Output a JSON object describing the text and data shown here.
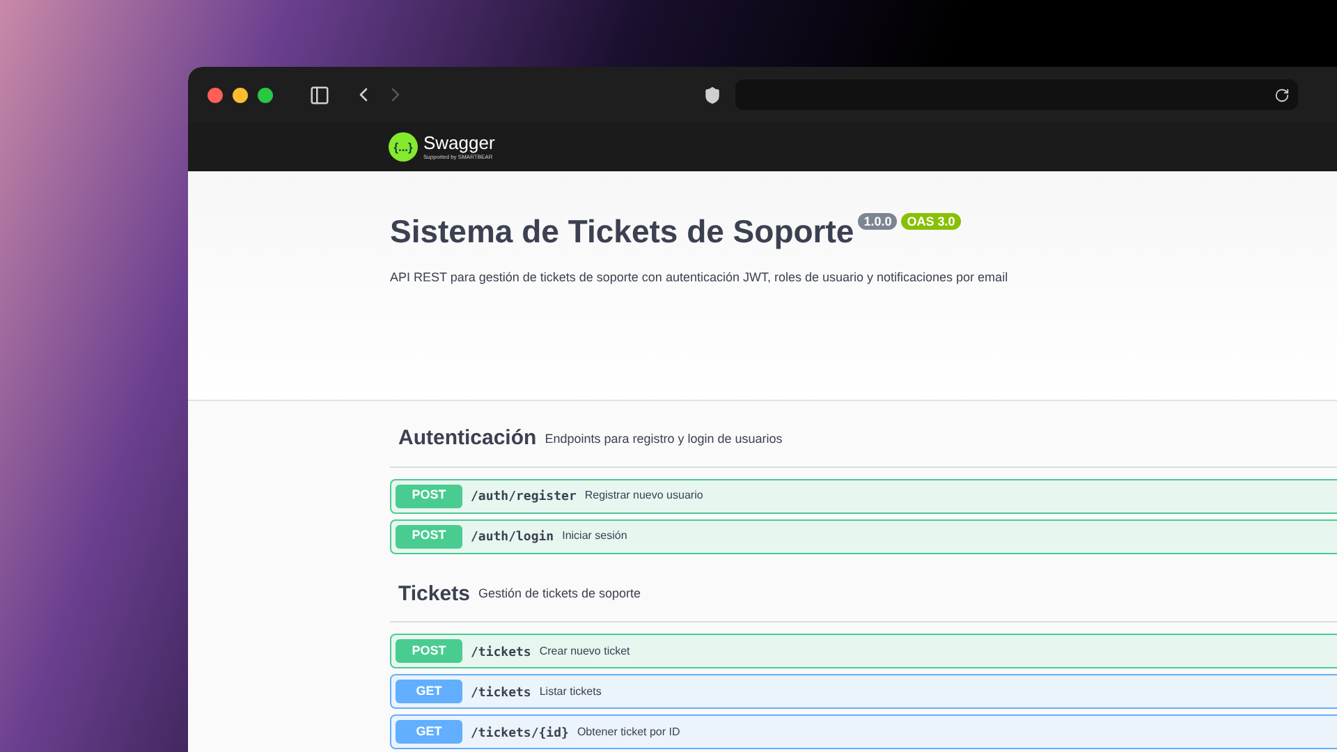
{
  "browser": {
    "back_enabled": true,
    "forward_enabled": false
  },
  "header": {
    "logo_mark": "{...}",
    "logo": "Swagger",
    "tagline": "Supported by SMARTBEAR"
  },
  "info": {
    "title": "Sistema de Tickets de Soporte",
    "version": "1.0.0",
    "oas": "OAS 3.0",
    "description": "API REST para gestión de tickets de soporte con autenticación JWT, roles de usuario y notificaciones por email"
  },
  "sections": [
    {
      "name": "Autenticación",
      "description": "Endpoints para registro y login de usuarios",
      "operations": [
        {
          "method": "POST",
          "path": "/auth/register",
          "summary": "Registrar nuevo usuario"
        },
        {
          "method": "POST",
          "path": "/auth/login",
          "summary": "Iniciar sesión"
        }
      ]
    },
    {
      "name": "Tickets",
      "description": "Gestión de tickets de soporte",
      "operations": [
        {
          "method": "POST",
          "path": "/tickets",
          "summary": "Crear nuevo ticket"
        },
        {
          "method": "GET",
          "path": "/tickets",
          "summary": "Listar tickets"
        },
        {
          "method": "GET",
          "path": "/tickets/{id}",
          "summary": "Obtener ticket por ID"
        }
      ]
    }
  ]
}
